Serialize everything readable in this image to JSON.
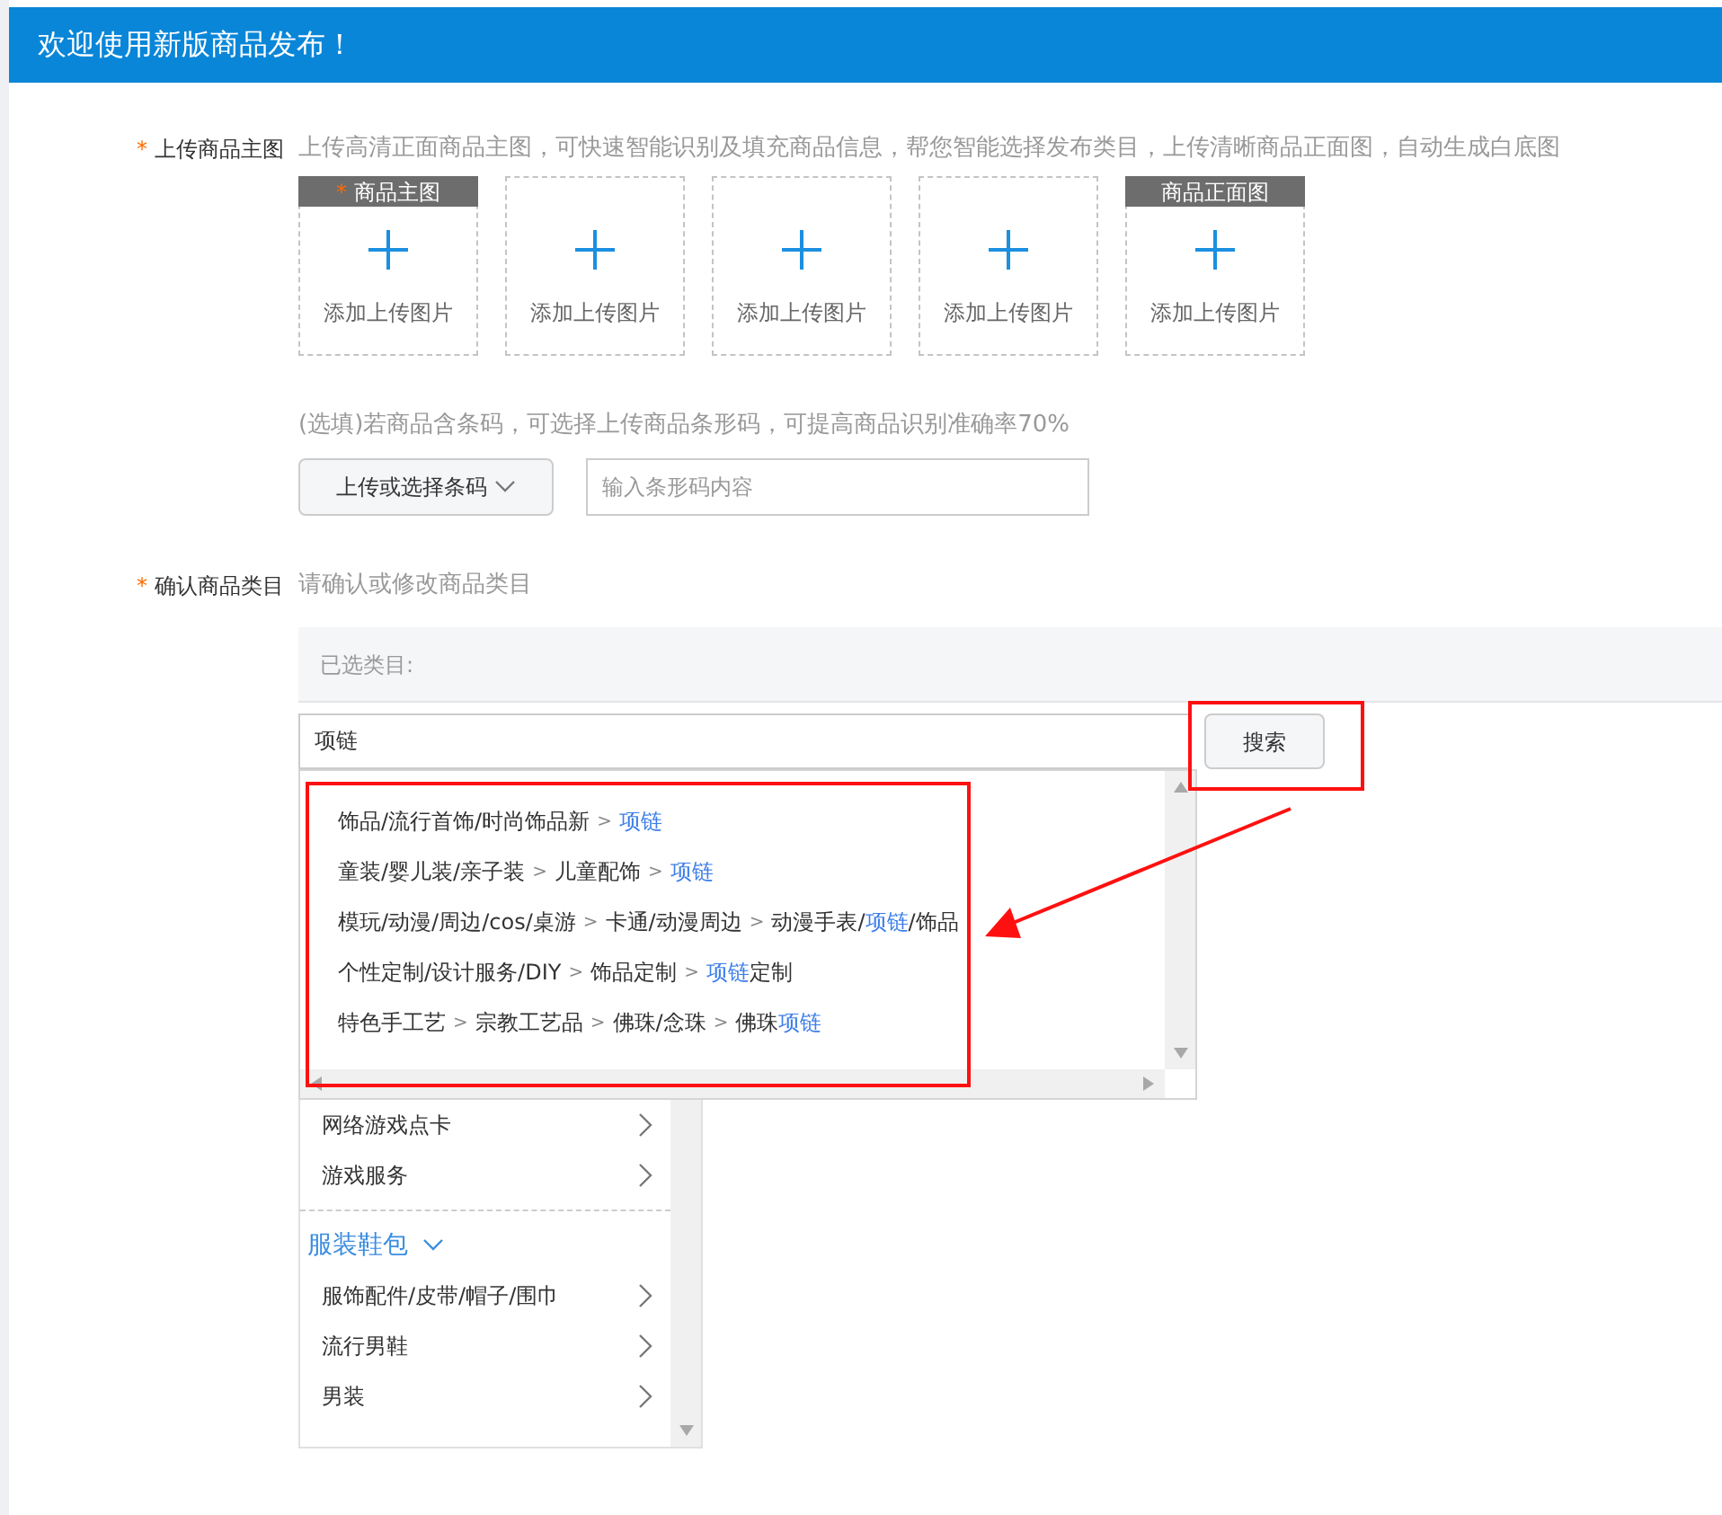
{
  "header": {
    "title": "欢迎使用新版商品发布！"
  },
  "main_image": {
    "label": "上传商品主图",
    "mark": "*",
    "hint": "上传高清正面商品主图，可快速智能识别及填充商品信息，帮您智能选择发布类目，上传清晰商品正面图，自动生成白底图",
    "slots": [
      {
        "tag": "商品主图",
        "tag_mark": "*",
        "text": "添加上传图片"
      },
      {
        "text": "添加上传图片"
      },
      {
        "text": "添加上传图片"
      },
      {
        "text": "添加上传图片"
      },
      {
        "tag": "商品正面图",
        "text": "添加上传图片"
      }
    ]
  },
  "barcode": {
    "hint": "(选填)若商品含条码，可选择上传商品条形码，可提高商品识别准确率70%",
    "button": "上传或选择条码",
    "placeholder": "输入条形码内容"
  },
  "category": {
    "label": "确认商品类目",
    "mark": "*",
    "hint": "请确认或修改商品类目",
    "selected_label": "已选类目:",
    "search_value": "项链",
    "search_button": "搜索",
    "suggestions": [
      [
        {
          "kind": "plain",
          "text": "饰品/流行首饰/时尚饰品新"
        },
        {
          "kind": "sep",
          "text": ">"
        },
        {
          "kind": "match",
          "text": "项链"
        }
      ],
      [
        {
          "kind": "plain",
          "text": "童装/婴儿装/亲子装"
        },
        {
          "kind": "sep",
          "text": ">"
        },
        {
          "kind": "plain",
          "text": "儿童配饰"
        },
        {
          "kind": "sep",
          "text": ">"
        },
        {
          "kind": "match",
          "text": "项链"
        }
      ],
      [
        {
          "kind": "plain",
          "text": "模玩/动漫/周边/cos/桌游"
        },
        {
          "kind": "sep",
          "text": ">"
        },
        {
          "kind": "plain",
          "text": "卡通/动漫周边"
        },
        {
          "kind": "sep",
          "text": ">"
        },
        {
          "kind": "plain",
          "text": "动漫手表/"
        },
        {
          "kind": "match",
          "text": "项链"
        },
        {
          "kind": "plain",
          "text": "/饰品"
        }
      ],
      [
        {
          "kind": "plain",
          "text": "个性定制/设计服务/DIY"
        },
        {
          "kind": "sep",
          "text": ">"
        },
        {
          "kind": "plain",
          "text": "饰品定制"
        },
        {
          "kind": "sep",
          "text": ">"
        },
        {
          "kind": "match",
          "text": "项链"
        },
        {
          "kind": "plain",
          "text": "定制"
        }
      ],
      [
        {
          "kind": "plain",
          "text": "特色手工艺"
        },
        {
          "kind": "sep",
          "text": ">"
        },
        {
          "kind": "plain",
          "text": "宗教工艺品"
        },
        {
          "kind": "sep",
          "text": ">"
        },
        {
          "kind": "plain",
          "text": "佛珠/念珠"
        },
        {
          "kind": "sep",
          "text": ">"
        },
        {
          "kind": "plain",
          "text": "佛珠"
        },
        {
          "kind": "match",
          "text": "项链"
        }
      ]
    ],
    "tree": [
      {
        "kind": "item",
        "text": "网络游戏点卡"
      },
      {
        "kind": "item",
        "text": "游戏服务"
      },
      {
        "kind": "group",
        "text": "服装鞋包",
        "expanded": true
      },
      {
        "kind": "item",
        "text": "服饰配件/皮带/帽子/围巾"
      },
      {
        "kind": "item",
        "text": "流行男鞋"
      },
      {
        "kind": "item",
        "text": "男装"
      }
    ]
  }
}
